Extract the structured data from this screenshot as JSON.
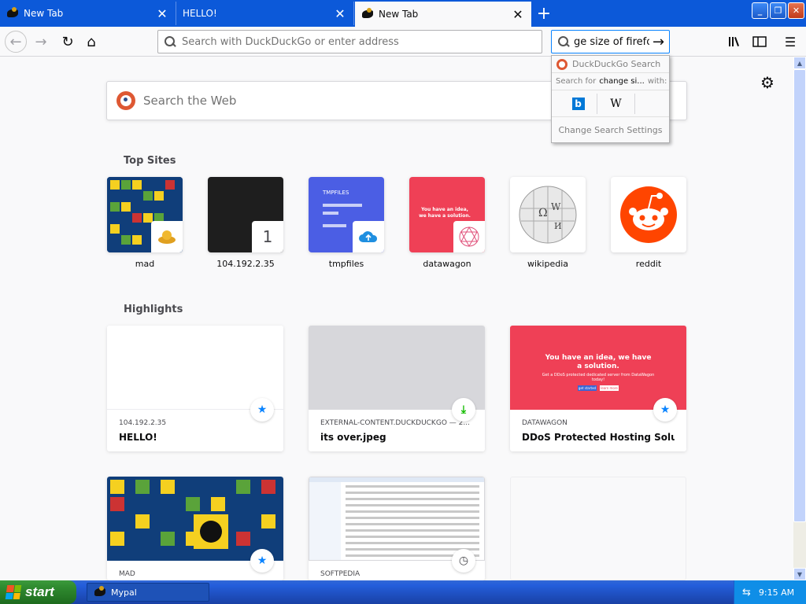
{
  "tabs": [
    {
      "label": "New Tab",
      "active": false
    },
    {
      "label": "HELLO!",
      "active": false
    },
    {
      "label": "New Tab",
      "active": true
    }
  ],
  "urlbar": {
    "placeholder": "Search with DuckDuckGo or enter address"
  },
  "searchbar": {
    "value": "ge size of firefo"
  },
  "search_popup": {
    "engine": "DuckDuckGo Search",
    "for_prefix": "Search for",
    "for_term": "change si...",
    "for_suffix": "with:",
    "engines": [
      "bing",
      "wikipedia"
    ],
    "settings_label": "Change Search Settings"
  },
  "page_search": {
    "placeholder": "Search the Web"
  },
  "top_sites": {
    "title": "Top Sites",
    "items": [
      {
        "label": "mad"
      },
      {
        "label": "104.192.2.35",
        "badge": "1"
      },
      {
        "label": "tmpfiles",
        "thumb_title": "TMPFILES"
      },
      {
        "label": "datawagon",
        "thumb_title": "You have an idea, we have a solution."
      },
      {
        "label": "wikipedia"
      },
      {
        "label": "reddit"
      }
    ]
  },
  "highlights": {
    "title": "Highlights",
    "cards": [
      {
        "source": "104.192.2.35",
        "title": "HELLO!",
        "icon": "star-icon"
      },
      {
        "source": "EXTERNAL-CONTENT.DUCKDUCKGO — 2...",
        "title": "its over.jpeg",
        "icon": "download-icon"
      },
      {
        "source": "DATAWAGON",
        "title": "DDoS Protected Hosting Solutio...",
        "icon": "star-icon",
        "preview_heading": "You have an idea, we have a solution.",
        "preview_sub": "Get a DDoS protected dedicated server from DataWagon today!",
        "preview_btn1": "get started",
        "preview_btn2": "learn more"
      },
      {
        "source": "MAD",
        "title": "",
        "icon": "star-icon"
      },
      {
        "source": "SOFTPEDIA",
        "title": "",
        "icon": "clock-icon"
      },
      {
        "source": "",
        "title": ""
      }
    ]
  },
  "taskbar": {
    "start_label": "start",
    "task_label": "Mypal",
    "clock": "9:15 AM"
  },
  "colors": {
    "tabstrip": "#0c59d9",
    "datawagon_red": "#ef4056",
    "reddit_orange": "#ff4500",
    "tmpfiles_blue": "#4b5ee4",
    "accent_blue": "#0a84ff"
  }
}
